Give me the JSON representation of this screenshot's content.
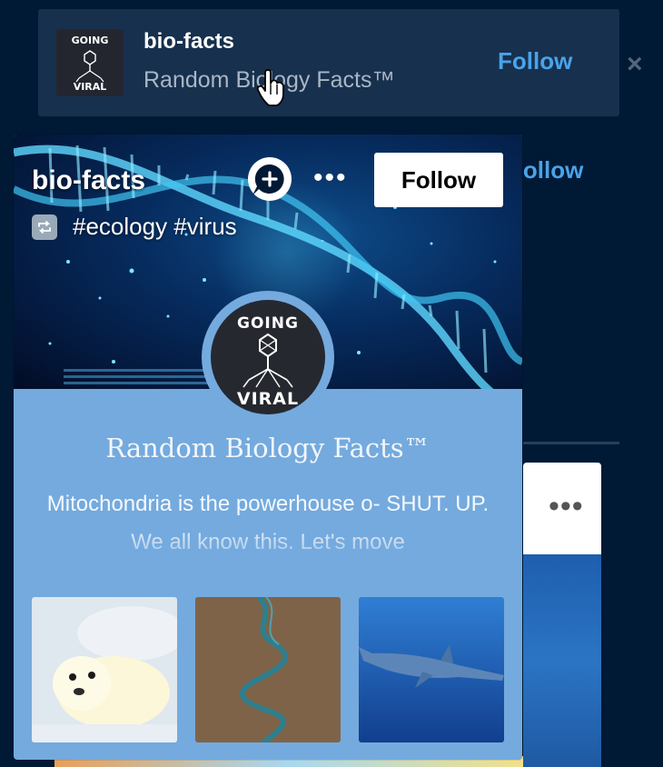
{
  "suggestion": {
    "name": "bio-facts",
    "title": "Random Biology Facts™",
    "follow_label": "Follow",
    "dismiss_icon": "×"
  },
  "background": {
    "follow_label": "Follow",
    "post_more_label": "•••"
  },
  "popover": {
    "name": "bio-facts",
    "tags": "#ecology #virus",
    "follow_label": "Follow",
    "more_label": "•••",
    "title": "Random Biology Facts™",
    "description": "Mitochondria is the powerhouse o- SHUT. UP. We all know this. Let's move",
    "avatar_top_text": "GOING",
    "avatar_bottom_text": "VIRAL",
    "thumbnails": [
      {
        "subject": "baby-seal"
      },
      {
        "subject": "river-aerial"
      },
      {
        "subject": "shark-underwater"
      }
    ]
  },
  "colors": {
    "page_bg": "#001935",
    "accent_link": "#4aa3e8",
    "card_bg": "#74aade",
    "follow_button_bg": "#ffffff"
  }
}
